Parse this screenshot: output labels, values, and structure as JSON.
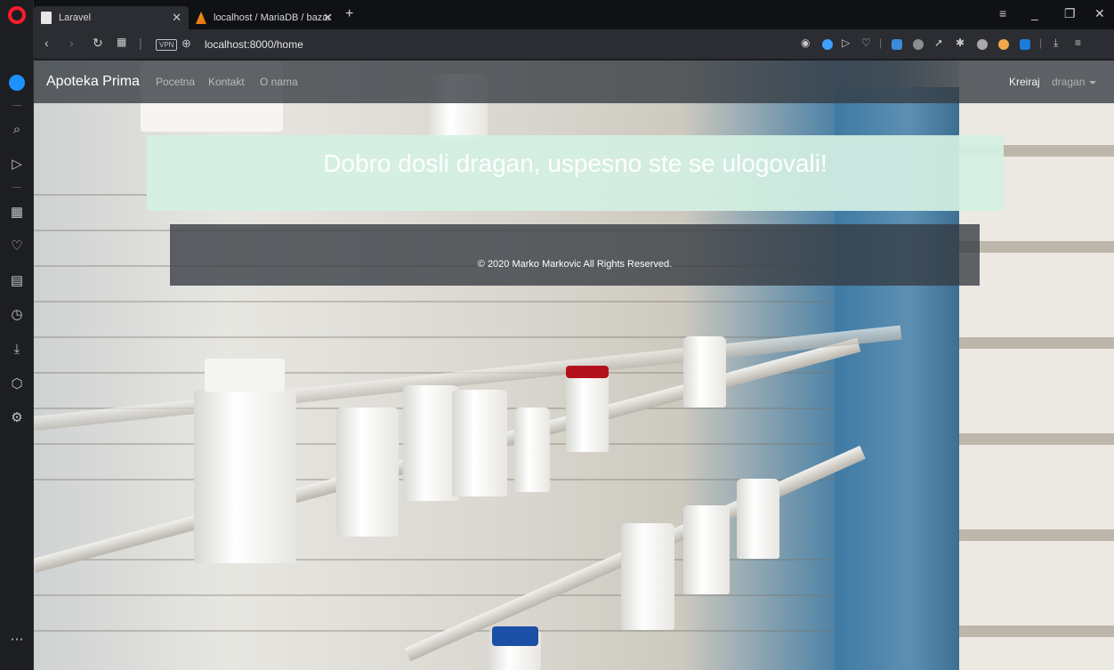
{
  "browser": {
    "tabs": [
      {
        "title": "Laravel",
        "close": "✕"
      },
      {
        "title": "localhost / MariaDB / bazar",
        "close": "✕"
      }
    ],
    "new_tab": "+",
    "url": "localhost:8000/home",
    "vpn_label": "VPN",
    "window_controls": {
      "menu": "≡",
      "minimize": "_",
      "maximize": "❐",
      "close": "✕"
    }
  },
  "site": {
    "brand": "Apoteka Prima",
    "nav": {
      "home": "Pocetna",
      "contact": "Kontakt",
      "about": "O nama"
    },
    "create": "Kreiraj",
    "user": "dragan"
  },
  "alert": {
    "message": "Dobro dosli dragan, uspesno ste se ulogovali!"
  },
  "footer": {
    "copyright": "© 2020 Marko Markovic All Rights Reserved."
  },
  "colors": {
    "navbar": "#343a40",
    "alert_bg": "#d4f0e3",
    "opera_red": "#ff1b2d"
  }
}
